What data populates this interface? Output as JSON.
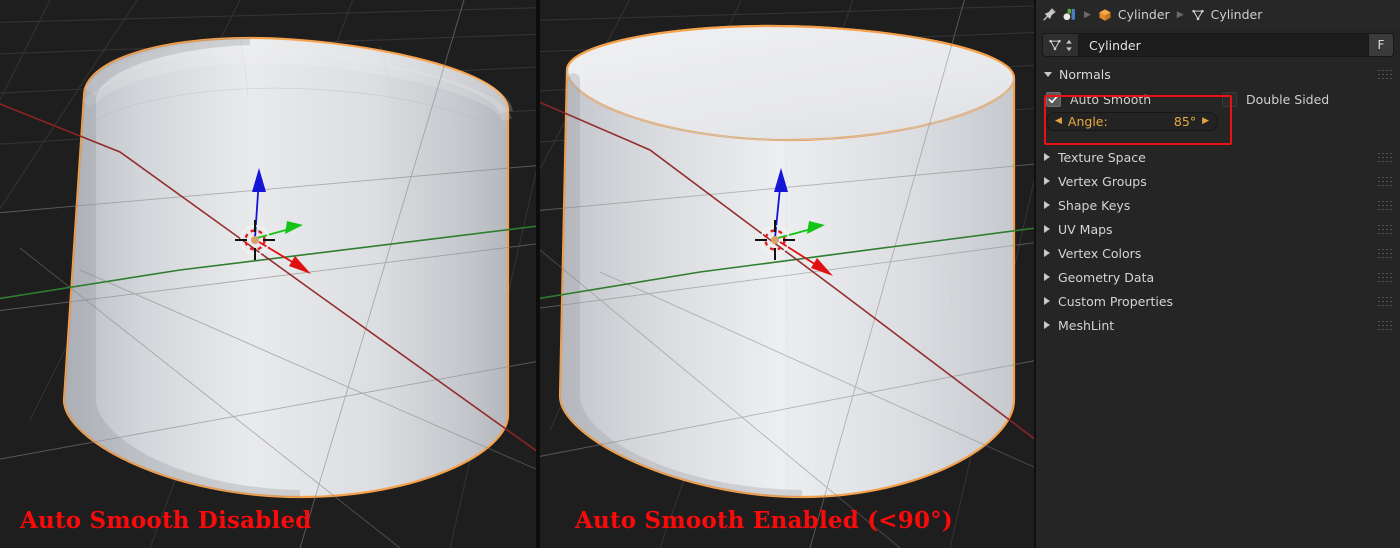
{
  "viewports": {
    "left": {
      "caption": "Auto Smooth Disabled",
      "object": "Cylinder",
      "shading": "smooth-no-autosmooth"
    },
    "right": {
      "caption": "Auto Smooth Enabled (<90°)",
      "object": "Cylinder",
      "shading": "smooth-autosmooth"
    },
    "caption_color": "#fa0a0a",
    "selection_outline_color": "#f5a04a",
    "background_color": "#1e1e1e",
    "axis_x_color": "#9e2b2b",
    "axis_y_color": "#2f7d2f",
    "gizmo": {
      "z_axis_color": "#1515d8",
      "y_axis_color": "#14c414",
      "x_axis_color": "#e01010",
      "cursor_name": "3d-cursor"
    }
  },
  "properties": {
    "breadcrumb": {
      "pin_icon": "pin-icon",
      "editor_icon": "properties-editor-icon",
      "items": [
        {
          "icon": "object-icon",
          "label": "Cylinder"
        },
        {
          "icon": "mesh-data-icon",
          "label": "Cylinder"
        }
      ]
    },
    "name_field": {
      "icon": "mesh-data-icon",
      "value": "Cylinder",
      "fake_user_label": "F"
    },
    "normals": {
      "title": "Normals",
      "auto_smooth": {
        "label": "Auto Smooth",
        "checked": true
      },
      "double_sided": {
        "label": "Double Sided",
        "checked": false
      },
      "angle": {
        "label": "Angle:",
        "value": "85°"
      },
      "highlight_color": "#ee1111",
      "accent_color": "#e8a93f"
    },
    "panels": [
      {
        "label": "Texture Space",
        "expanded": false
      },
      {
        "label": "Vertex Groups",
        "expanded": false
      },
      {
        "label": "Shape Keys",
        "expanded": false
      },
      {
        "label": "UV Maps",
        "expanded": false
      },
      {
        "label": "Vertex Colors",
        "expanded": false
      },
      {
        "label": "Geometry Data",
        "expanded": false
      },
      {
        "label": "Custom Properties",
        "expanded": false
      },
      {
        "label": "MeshLint",
        "expanded": false
      }
    ]
  }
}
